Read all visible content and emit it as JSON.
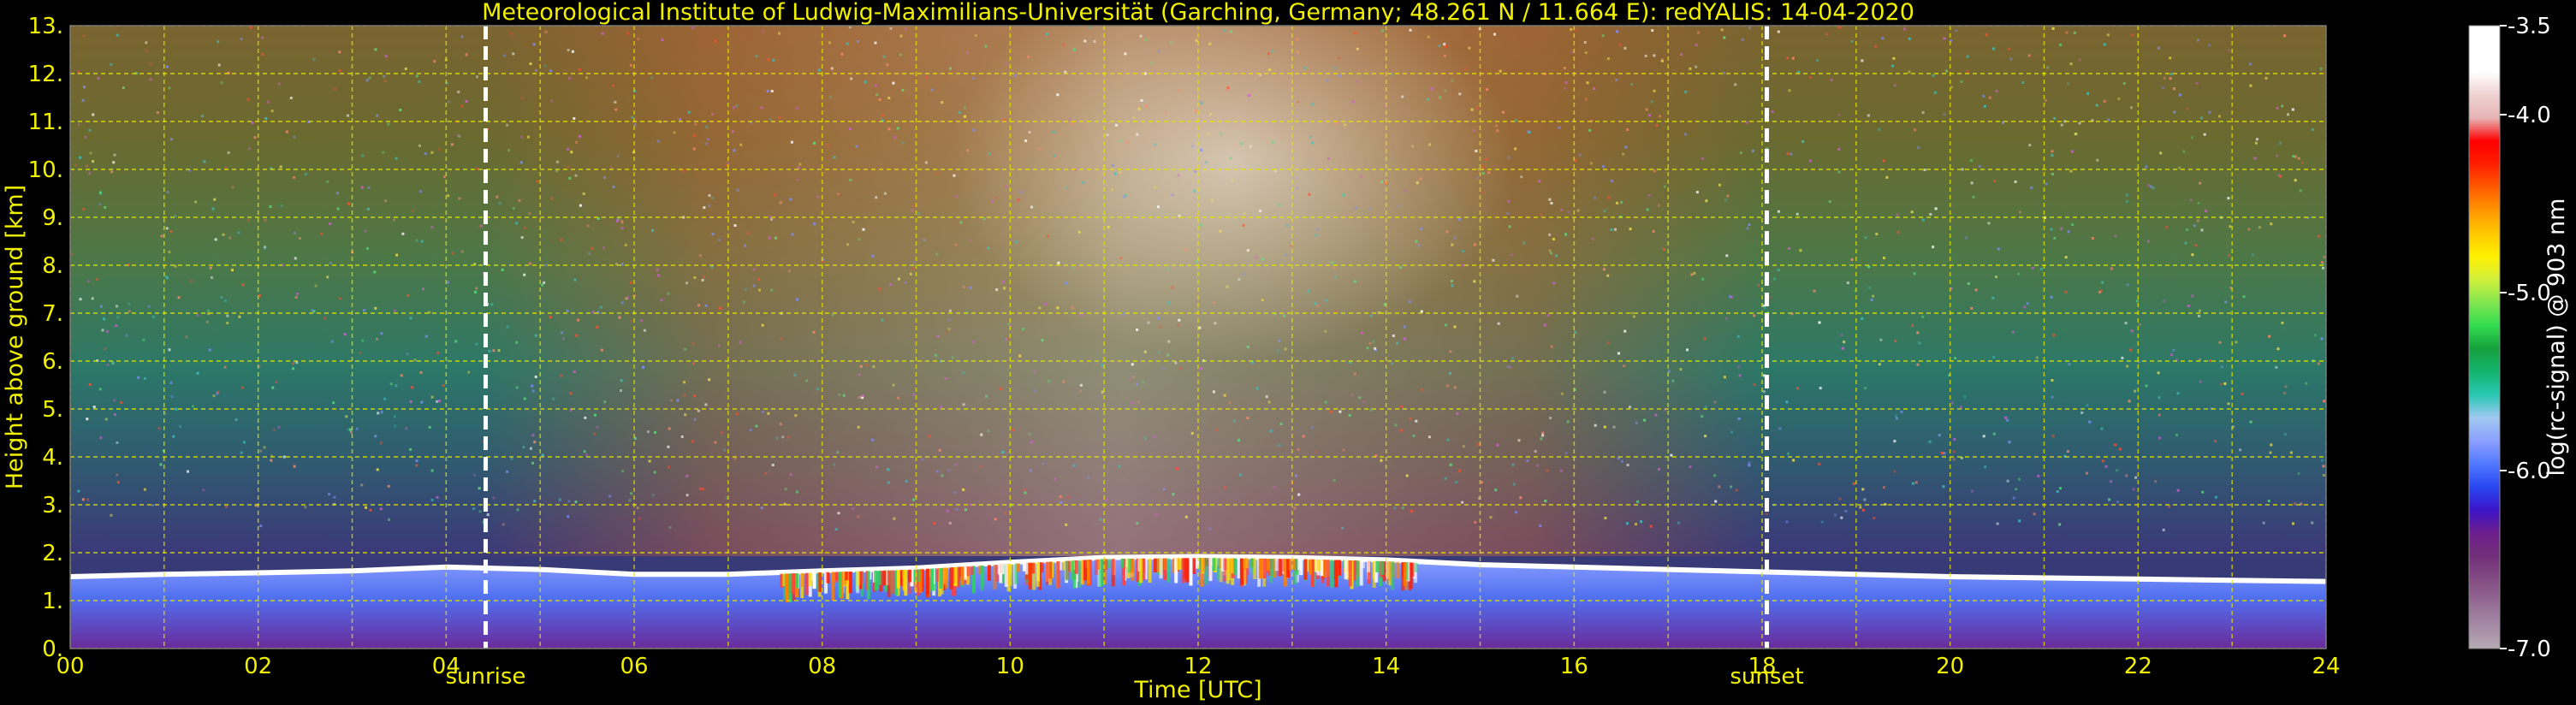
{
  "chart_data": {
    "type": "heatmap",
    "title": "Meteorological Institute of Ludwig-Maximilians-Universität (Garching, Germany; 48.261 N / 11.664 E):    redYALIS: 14-04-2020",
    "xlabel": "Time [UTC]",
    "ylabel": "Height above ground [km]",
    "xlim": [
      0,
      24
    ],
    "ylim": [
      0,
      13
    ],
    "x_ticks": [
      "00",
      "02",
      "04",
      "06",
      "08",
      "10",
      "12",
      "14",
      "16",
      "18",
      "20",
      "22",
      "24"
    ],
    "y_ticks": [
      "0.",
      "1.",
      "2.",
      "3.",
      "4.",
      "5.",
      "6.",
      "7.",
      "8.",
      "9.",
      "10.",
      "11.",
      "12.",
      "13."
    ],
    "grid": true,
    "grid_color": "#e6e600",
    "background": "#000000",
    "annotations": [
      {
        "label": "sunrise",
        "x": 4.42
      },
      {
        "label": "sunset",
        "x": 18.05
      }
    ],
    "boundary_layer_top_km": [
      [
        0.0,
        1.5
      ],
      [
        1.0,
        1.55
      ],
      [
        2.0,
        1.58
      ],
      [
        3.0,
        1.62
      ],
      [
        4.0,
        1.7
      ],
      [
        5.0,
        1.65
      ],
      [
        6.0,
        1.55
      ],
      [
        7.0,
        1.55
      ],
      [
        8.0,
        1.62
      ],
      [
        9.0,
        1.68
      ],
      [
        10.0,
        1.8
      ],
      [
        11.0,
        1.9
      ],
      [
        12.0,
        1.92
      ],
      [
        13.0,
        1.9
      ],
      [
        14.0,
        1.85
      ],
      [
        15.0,
        1.75
      ],
      [
        16.0,
        1.7
      ],
      [
        17.0,
        1.65
      ],
      [
        18.0,
        1.6
      ],
      [
        20.0,
        1.5
      ],
      [
        22.0,
        1.45
      ],
      [
        24.0,
        1.4
      ]
    ],
    "colorbar": {
      "label": "log(rc-signal) @ 903 nm",
      "range": [
        -7.0,
        -3.5
      ],
      "ticks": [
        "-3.5",
        "-4.0",
        "-5.0",
        "-6.0",
        "-7.0"
      ],
      "tick_values": [
        -3.5,
        -4.0,
        -5.0,
        -6.0,
        -7.0
      ],
      "colors": [
        "#b6aab4",
        "#a58aa5",
        "#946b94",
        "#834b83",
        "#72307a",
        "#6e1e8c",
        "#3c14c8",
        "#2846f0",
        "#5078ff",
        "#8ca0ff",
        "#a0c8f0",
        "#28c8b4",
        "#14b46e",
        "#14a03c",
        "#32dc50",
        "#82e650",
        "#d2f03c",
        "#fff000",
        "#ffc800",
        "#ff9600",
        "#ff5a00",
        "#ff1e00",
        "#ff0000",
        "#e6b4b4",
        "#f0d2d2",
        "#ffffff",
        "#ffffff",
        "#ffffff"
      ]
    }
  }
}
